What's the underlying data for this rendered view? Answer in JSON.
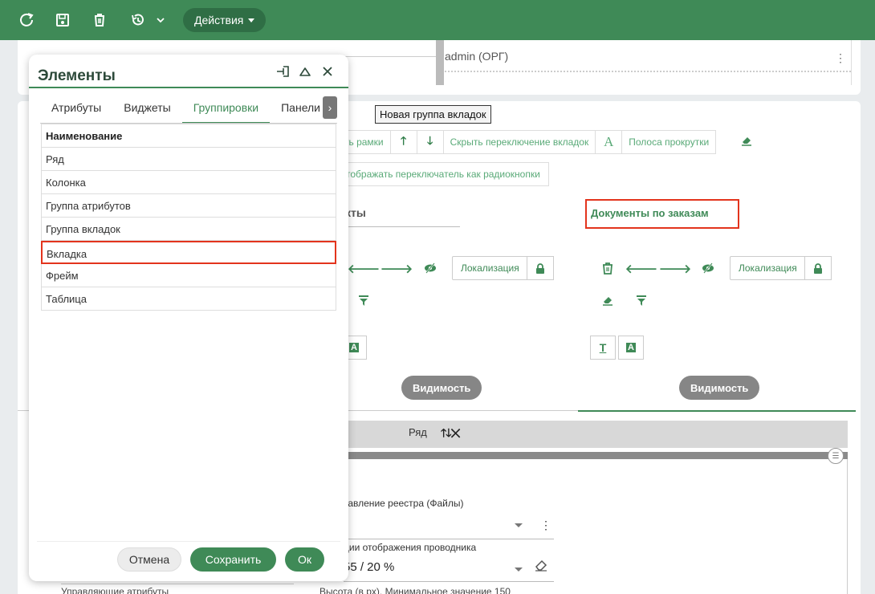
{
  "toolbar": {
    "actions_label": "Действия",
    "icons": [
      "refresh-icon",
      "save-icon",
      "trash-icon",
      "history-icon",
      "chevron-down-icon"
    ]
  },
  "background": {
    "admin_value": "admin (ОРГ)",
    "tooltip": "Новая группа вкладок",
    "strip_buttons": {
      "borders": "ть рамки",
      "hide_tabs": "Скрыть переключение вкладок",
      "scroll": "Полоса прокрутки",
      "radio": "тображать переключатель как радиокнопки"
    },
    "tab_left": "кты",
    "tab_right": "Документы по заказам",
    "localization": "Локализация",
    "visibility": "Видимость",
    "row_label": "Ряд",
    "field1_label": "тавление реестра (Файлы)",
    "field2_label": "ции отображения проводника",
    "field2_value": "55 / 20 %",
    "bottom_left": "Управляющие атрибуты",
    "bottom_right": "Высота (в px). Минимальное значение 150"
  },
  "modal": {
    "title": "Элементы",
    "tabs": [
      "Атрибуты",
      "Виджеты",
      "Группировки",
      "Панели"
    ],
    "active_tab": "Группировки",
    "table_header": "Наименование",
    "rows": [
      "Ряд",
      "Колонка",
      "Группа атрибутов",
      "Группа вкладок",
      "Вкладка",
      "Фрейм",
      "Таблица"
    ],
    "selected_row": "Вкладка",
    "cancel": "Отмена",
    "save": "Сохранить",
    "ok": "Ок"
  },
  "colors": {
    "brand_green": "#3f8a57",
    "highlight_red": "#e3341d"
  }
}
